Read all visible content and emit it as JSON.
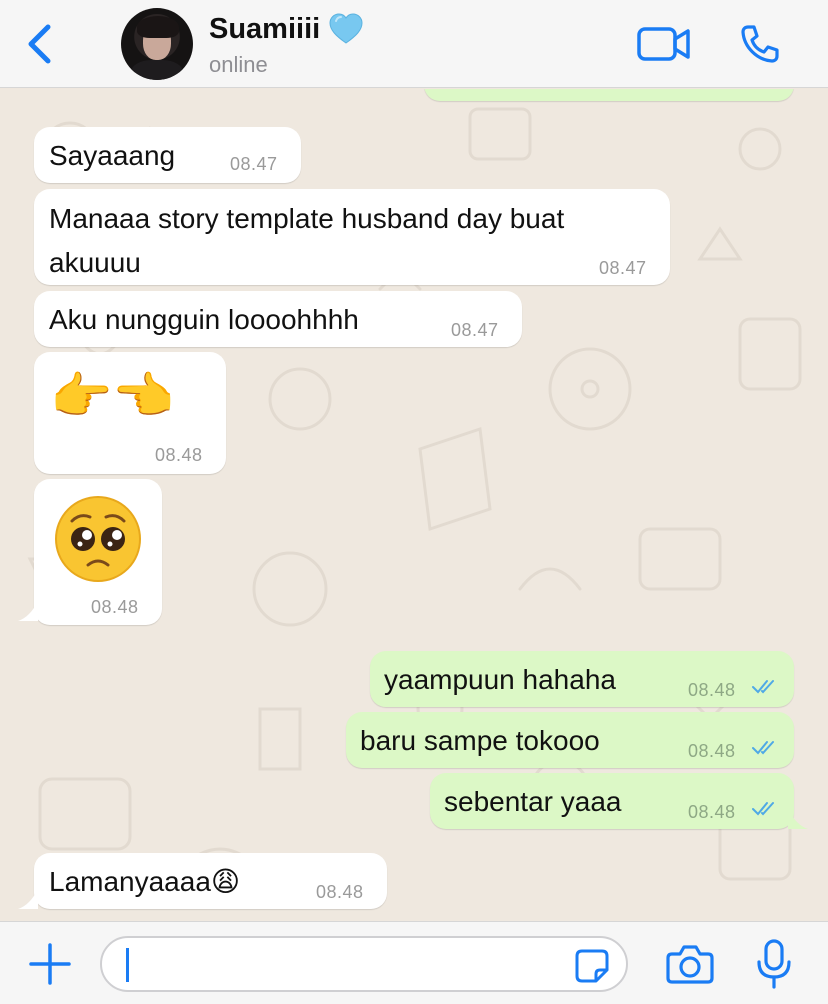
{
  "header": {
    "contact_name": "Suamiiii",
    "status": "online",
    "back_icon": "chevron-left-icon",
    "video_icon": "video-camera-icon",
    "call_icon": "phone-icon",
    "accent": "#1a7cf4"
  },
  "messages": [
    {
      "direction": "in",
      "text": "Sayaaang",
      "time": "08.47"
    },
    {
      "direction": "in",
      "text": "Manaaa story template husband day buat akuuuu",
      "time": "08.47"
    },
    {
      "direction": "in",
      "text": "Aku nungguin loooohhhh",
      "time": "08.47"
    },
    {
      "direction": "in",
      "text": "👉👈",
      "time": "08.48"
    },
    {
      "direction": "in",
      "text": "🥺",
      "time": "08.48"
    },
    {
      "direction": "out",
      "text": "yaampuun hahaha",
      "time": "08.48",
      "status": "read"
    },
    {
      "direction": "out",
      "text": "baru sampe tokooo",
      "time": "08.48",
      "status": "read"
    },
    {
      "direction": "out",
      "text": "sebentar yaaa",
      "time": "08.48",
      "status": "read"
    },
    {
      "direction": "in",
      "text": "Lamanyaaaa😩",
      "time": "08.48"
    }
  ],
  "composer": {
    "value": "",
    "add_icon": "plus-icon",
    "sticker_icon": "sticker-icon",
    "camera_icon": "camera-icon",
    "mic_icon": "microphone-icon"
  },
  "colors": {
    "incoming_bubble": "#ffffff",
    "outgoing_bubble": "#dcf8c6",
    "read_ticks": "#4fa9e6",
    "wallpaper": "#efe8df"
  }
}
